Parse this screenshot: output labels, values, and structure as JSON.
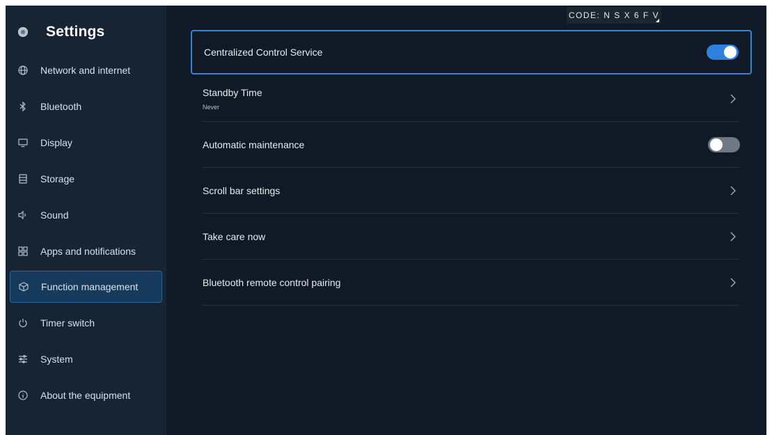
{
  "sidebar": {
    "title": "Settings",
    "items": [
      {
        "label": "Network and internet",
        "icon": "globe-icon"
      },
      {
        "label": "Bluetooth",
        "icon": "bluetooth-icon"
      },
      {
        "label": "Display",
        "icon": "monitor-icon"
      },
      {
        "label": "Storage",
        "icon": "storage-icon"
      },
      {
        "label": "Sound",
        "icon": "speaker-icon"
      },
      {
        "label": "Apps and notifications",
        "icon": "apps-grid-icon"
      },
      {
        "label": "Function management",
        "icon": "cube-icon",
        "active": true
      },
      {
        "label": "Timer switch",
        "icon": "power-icon"
      },
      {
        "label": "System",
        "icon": "sliders-icon"
      },
      {
        "label": "About the equipment",
        "icon": "info-icon"
      }
    ]
  },
  "code_tag": {
    "text": "CODE: N S X 6 F V"
  },
  "settings": [
    {
      "label": "Centralized Control Service",
      "control": "toggle",
      "on": true,
      "focused": true
    },
    {
      "label": "Standby Time",
      "sub": "Never",
      "control": "chevron"
    },
    {
      "label": "Automatic maintenance",
      "control": "toggle",
      "on": false
    },
    {
      "label": "Scroll bar settings",
      "control": "chevron"
    },
    {
      "label": "Take care now",
      "control": "chevron"
    },
    {
      "label": "Bluetooth remote control pairing",
      "control": "chevron"
    }
  ],
  "colors": {
    "background": "#0f1a26",
    "sidebar": "#162434",
    "accent": "#2d7fe0",
    "active_item": "#163b5c"
  }
}
